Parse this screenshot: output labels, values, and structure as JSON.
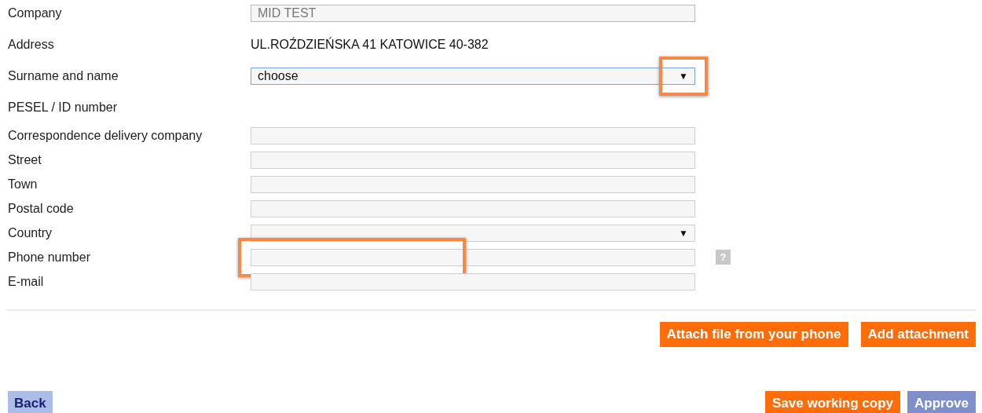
{
  "fields": [
    {
      "label": "Company",
      "kind": "input",
      "value": "MID TEST",
      "readonly": true
    },
    {
      "label": "Address",
      "kind": "text",
      "value": "UL.ROŹDZIEŃSKA 41 KATOWICE 40-382"
    },
    {
      "label": "Surname and name",
      "kind": "select",
      "value": "choose",
      "focused": true,
      "arrow": "▼",
      "highlighted": true
    },
    {
      "label": "PESEL / ID number",
      "kind": "text"
    },
    {
      "label": "Correspondence delivery company",
      "kind": "input"
    },
    {
      "label": "Street",
      "kind": "input"
    },
    {
      "label": "Town",
      "kind": "input"
    },
    {
      "label": "Postal code",
      "kind": "input"
    },
    {
      "label": "Country",
      "kind": "select",
      "arrow": "▼"
    },
    {
      "label": "Phone number",
      "kind": "input",
      "help": "?",
      "highlighted": true
    },
    {
      "label": "E-mail",
      "kind": "input"
    }
  ],
  "attach_buttons": [
    "Attach file from your phone",
    "Add attachment"
  ],
  "back_button": "Back",
  "action_buttons": [
    {
      "label": "Save working copy",
      "kind": "primary"
    },
    {
      "label": "Approve",
      "kind": "secondary"
    }
  ]
}
